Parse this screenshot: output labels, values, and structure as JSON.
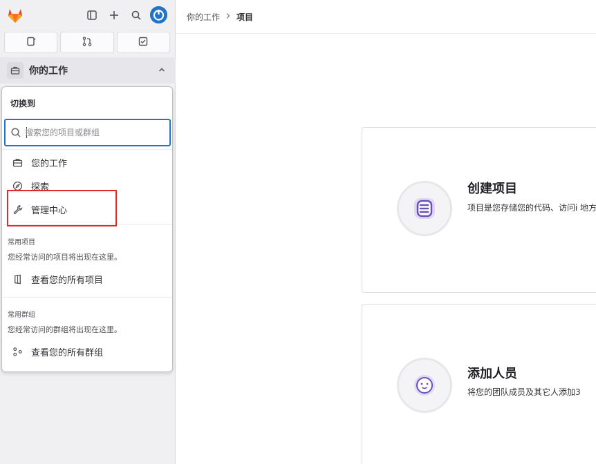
{
  "sidebar": {
    "context_label": "你的工作",
    "panel": {
      "title": "切换到",
      "search_placeholder": "搜索您的项目或群组",
      "items": [
        {
          "label": "您的工作",
          "icon": "briefcase-icon"
        },
        {
          "label": "探索",
          "icon": "compass-icon"
        },
        {
          "label": "管理中心",
          "icon": "wrench-icon"
        }
      ],
      "frequent_projects": {
        "label": "常用项目",
        "empty": "您经常访问的项目将出现在这里。",
        "view_all": "查看您的所有项目"
      },
      "frequent_groups": {
        "label": "常用群组",
        "empty": "您经常访问的群组将出现在这里。",
        "view_all": "查看您的所有群组"
      }
    }
  },
  "breadcrumb": {
    "parent": "你的工作",
    "current": "项目"
  },
  "cards": [
    {
      "title": "创建项目",
      "desc": "项目是您存储您的代码、访问i 地方。"
    },
    {
      "title": "添加人员",
      "desc": "将您的团队成员及其它人添加3"
    }
  ],
  "colors": {
    "accent": "#1f75cb",
    "highlight": "#dd2b2b",
    "purple": "#6b4fbb"
  }
}
